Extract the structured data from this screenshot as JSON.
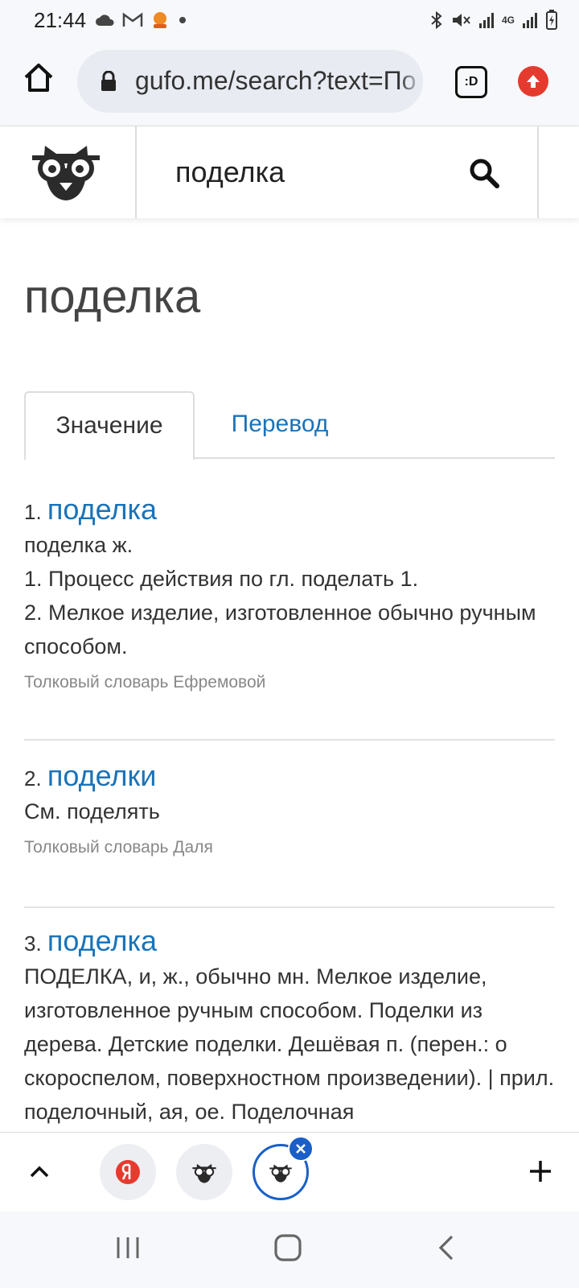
{
  "status_bar": {
    "time": "21:44",
    "left_icons": [
      "cloud-icon",
      "gmail-icon",
      "app-icon",
      "dot-icon"
    ],
    "right_icons": [
      "bluetooth-icon",
      "mute-icon",
      "signal-icon",
      "4g-icon",
      "signal-icon",
      "battery-icon"
    ],
    "network": "4G"
  },
  "browser": {
    "url": "gufo.me/search?text=По",
    "tab_counter": ":D"
  },
  "site": {
    "search_value": "поделка"
  },
  "page": {
    "title": "поделка",
    "tabs": [
      {
        "label": "Значение",
        "active": true
      },
      {
        "label": "Перевод",
        "active": false
      }
    ]
  },
  "entries": [
    {
      "num": "1.",
      "word": "поделка",
      "lines": [
        "поделка ж.",
        "1. Процесс действия по гл. поделать 1.",
        "2. Мелкое изделие, изготовленное обычно ручным способом."
      ],
      "source": "Толковый словарь Ефремовой"
    },
    {
      "num": "2.",
      "word": "поделки",
      "lines": [
        "См. поделять"
      ],
      "source": "Толковый словарь Даля"
    },
    {
      "num": "3.",
      "word": "поделка",
      "lines": [
        "ПОДЕЛКА, и, ж., обычно мн. Мелкое изделие, изготовленное ручным способом. Поделки из дерева. Детские поделки. Дешёвая п. (перен.: о скороспелом, поверхностном произведении). | прил. поделочный, ая, ое. Поделочная"
      ],
      "source": ""
    }
  ],
  "colors": {
    "link": "#1a73b8",
    "active_tab": "#1a5fc8",
    "update": "#e53b2f"
  }
}
